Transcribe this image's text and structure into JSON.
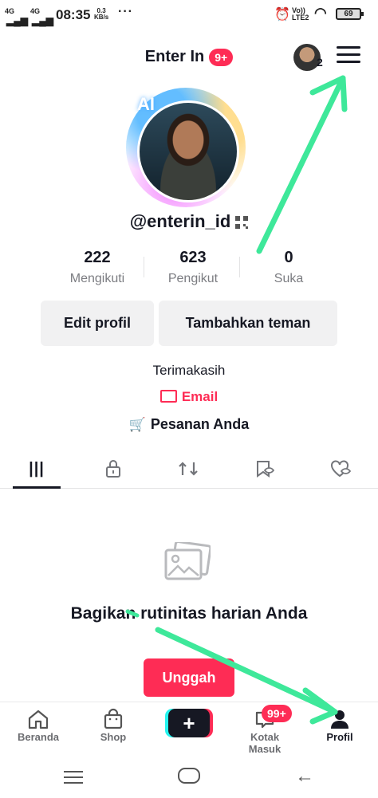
{
  "status_bar": {
    "signal1": "4G",
    "signal2": "4G",
    "time": "08:35",
    "net_speed_value": "0.3",
    "net_speed_unit": "KB/s",
    "more": "···",
    "lte_top": "Vo))",
    "lte_bottom": "LTE2",
    "battery": "69"
  },
  "header": {
    "title": "Enter In",
    "notification_badge": "9+",
    "account_count": "2"
  },
  "profile": {
    "ai_tag": "AI",
    "username": "@enterin_id",
    "stats": [
      {
        "value": "222",
        "label": "Mengikuti"
      },
      {
        "value": "623",
        "label": "Pengikut"
      },
      {
        "value": "0",
        "label": "Suka"
      }
    ],
    "edit_button": "Edit profil",
    "add_friend_button": "Tambahkan teman",
    "bio": "Terimakasih",
    "email_label": "Email",
    "orders_label": "Pesanan Anda"
  },
  "tabs": [
    {
      "icon": "grid-icon",
      "active": true
    },
    {
      "icon": "lock-icon",
      "active": false
    },
    {
      "icon": "repost-icon",
      "active": false
    },
    {
      "icon": "bookmark-icon",
      "active": false
    },
    {
      "icon": "liked-heart-icon",
      "active": false
    }
  ],
  "empty_state": {
    "message": "Bagikan rutinitas harian Anda",
    "upload_button": "Unggah"
  },
  "bottom_nav": {
    "items": [
      {
        "label": "Beranda",
        "icon": "home-icon"
      },
      {
        "label": "Shop",
        "icon": "shop-icon"
      },
      {
        "label": "",
        "icon": "plus-icon"
      },
      {
        "label": "Kotak Masuk",
        "icon": "inbox-icon"
      },
      {
        "label": "Profil",
        "icon": "profile-icon"
      }
    ],
    "inbox_badge": "99+"
  },
  "colors": {
    "accent": "#fe2c55",
    "cyan": "#25f4ee",
    "annotation_arrow": "#3ee89a",
    "text": "#161823"
  }
}
